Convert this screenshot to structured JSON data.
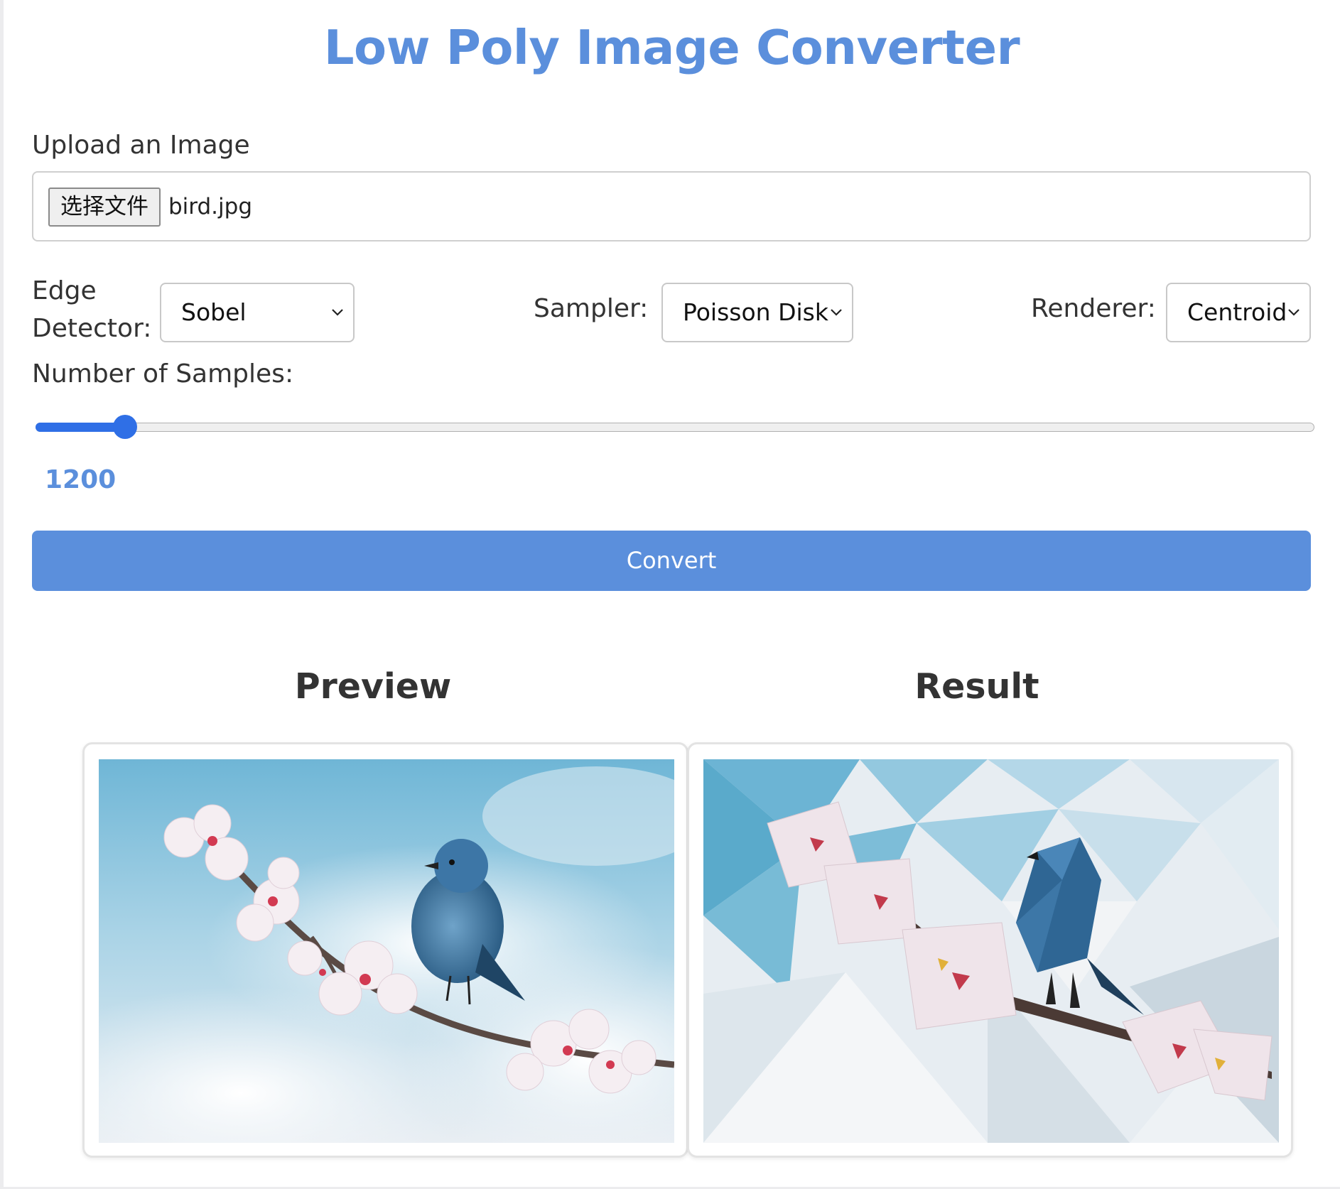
{
  "title": "Low Poly Image Converter",
  "upload": {
    "label": "Upload an Image",
    "button_label": "选择文件",
    "file_name": "bird.jpg"
  },
  "controls": {
    "edge_detector": {
      "label_line1": "Edge",
      "label_line2": "Detector:",
      "value": "Sobel"
    },
    "sampler": {
      "label": "Sampler:",
      "value": "Poisson Disk"
    },
    "renderer": {
      "label": "Renderer:",
      "value": "Centroid"
    }
  },
  "samples": {
    "label": "Number of Samples:",
    "value": "1200",
    "fraction": 0.07
  },
  "convert_label": "Convert",
  "preview": {
    "heading": "Preview",
    "image_icon": "photo-bird-on-blossom-branch"
  },
  "result": {
    "heading": "Result",
    "image_icon": "low-poly-bird-on-blossom-branch"
  },
  "colors": {
    "accent": "#5b8fdc",
    "slider": "#2f6fe6",
    "text": "#333333"
  }
}
